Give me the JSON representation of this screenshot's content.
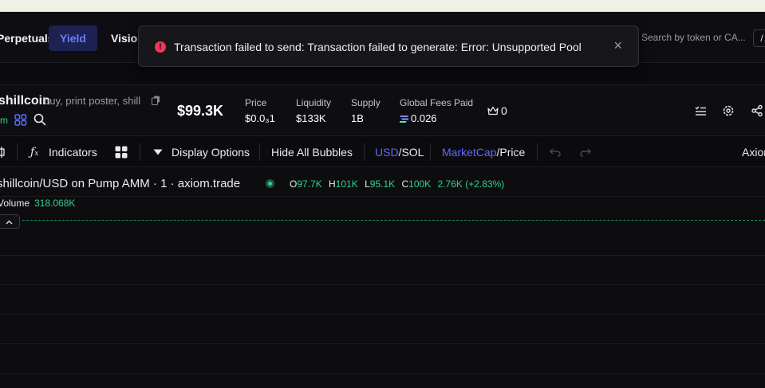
{
  "nav": {
    "items": [
      "Perpetuals",
      "Yield",
      "Vision"
    ],
    "search_placeholder": "Search by token or CA...",
    "search_shortcut": "/"
  },
  "toast": {
    "message": "Transaction failed to send: Transaction failed to generate: Error: Unsupported Pool",
    "close": "×"
  },
  "token": {
    "name": "shillcoin",
    "tagline": "buy, print poster, shill",
    "age": "m",
    "market_cap": "$99.3K",
    "stats": [
      {
        "label": "Price",
        "value": "$0.0₃1"
      },
      {
        "label": "Liquidity",
        "value": "$133K"
      },
      {
        "label": "Supply",
        "value": "1B"
      },
      {
        "label": "Global Fees Paid",
        "value": "0.026"
      }
    ],
    "holders": "0"
  },
  "toolbar": {
    "indicators": "Indicators",
    "display_options": "Display Options",
    "hide_bubbles": "Hide All Bubbles",
    "currency_active": "USD",
    "currency_alt": "/SOL",
    "metric_active": "MarketCap",
    "metric_alt": "/Price",
    "brand": "Axiom"
  },
  "chart": {
    "title": "shillcoin/USD on Pump AMM · 1 · axiom.trade",
    "ohlc": {
      "o_label": "O",
      "o": "97.7K",
      "h_label": "H",
      "h": "101K",
      "l_label": "L",
      "l": "95.1K",
      "c_label": "C",
      "c": "100K",
      "change": "2.76K (+2.83%)"
    },
    "volume_label": "Volume",
    "volume_value": "318.068K",
    "collapse": "^"
  },
  "colors": {
    "accent_blue": "#5b6bff",
    "positive_green": "#2fd08f",
    "error_red": "#f0365a"
  }
}
